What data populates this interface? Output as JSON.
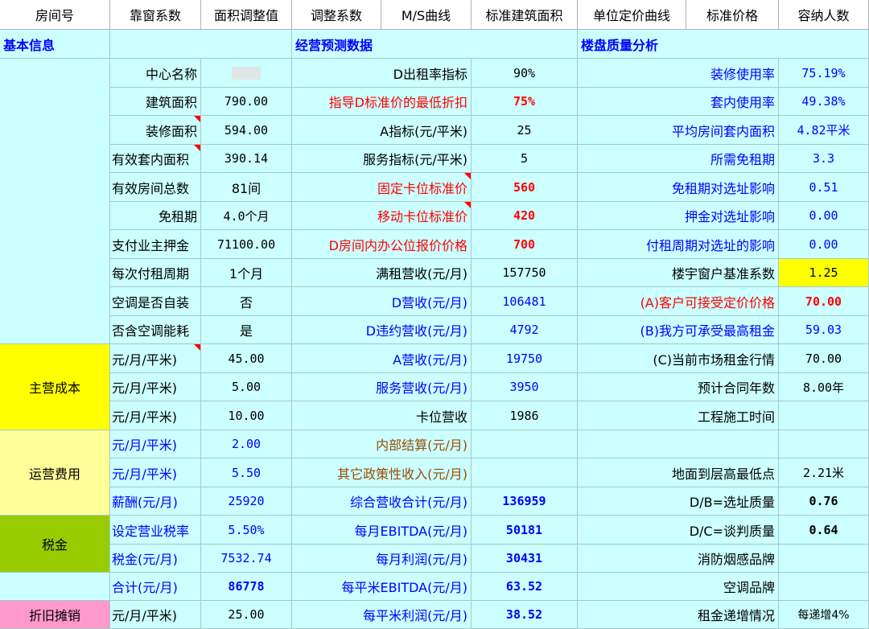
{
  "headers": [
    "房间号",
    "靠窗系数",
    "面积调整值",
    "调整系数",
    "M/S曲线",
    "标准建筑面积",
    "单位定价曲线",
    "标准价格",
    "容纳人数"
  ],
  "sections": {
    "basic": "基本信息",
    "forecast": "经营预测数据",
    "quality": "楼盘质量分析"
  },
  "categories": {
    "main_cost": "主营成本",
    "op_cost": "运营费用",
    "tax": "税金",
    "depreciation": "折旧摊销"
  },
  "colors": {
    "bg": "#ccffff",
    "yellow": "#ffff00",
    "light_yellow": "#ffff99",
    "green": "#99cc00",
    "pink": "#ff99cc",
    "red": "#ff0000",
    "blue": "#0000ff"
  },
  "rows": [
    {
      "a": "中心名称",
      "b": "",
      "c": "D出租率指标",
      "d": "90%",
      "e": "装修使用率",
      "f": "75.19%"
    },
    {
      "a": "建筑面积",
      "b": "790.00",
      "c": "指导D标准价的最低折扣",
      "d": "75%",
      "e": "套内使用率",
      "f": "49.38%"
    },
    {
      "a": "装修面积",
      "b": "594.00",
      "c": "A指标(元/平米)",
      "d": "25",
      "e": "平均房间套内面积",
      "f": "4.82平米"
    },
    {
      "a": "有效套内面积",
      "b": "390.14",
      "c": "服务指标(元/平米)",
      "d": "5",
      "e": "所需免租期",
      "f": "3.3"
    },
    {
      "a": "有效房间总数",
      "b": "81间",
      "c": "固定卡位标准价",
      "d": "560",
      "e": "免租期对选址影响",
      "f": "0.51"
    },
    {
      "a": "免租期",
      "b": "4.0个月",
      "c": "移动卡位标准价",
      "d": "420",
      "e": "押金对选址影响",
      "f": "0.00"
    },
    {
      "a": "支付业主押金",
      "b": "71100.00",
      "c": "D房间内办公位报价价格",
      "d": "700",
      "e": "付租周期对选址的影响",
      "f": "0.00"
    },
    {
      "a": "每次付租周期",
      "b": "1个月",
      "c": "满租营收(元/月)",
      "d": "157750",
      "e": "楼宇窗户基准系数",
      "f": "1.25"
    },
    {
      "a": "空调是否自装",
      "b": "否",
      "c": "D营收(元/月)",
      "d": "106481",
      "e": "(A)客户可接受定价价格",
      "f": "70.00"
    },
    {
      "a": "否含空调能耗",
      "b": "是",
      "c": "D违约营收(元/月)",
      "d": "4792",
      "e": "(B)我方可承受最高租金",
      "f": "59.03"
    },
    {
      "a": "元/月/平米)",
      "b": "45.00",
      "c": "A营收(元/月)",
      "d": "19750",
      "e": "(C)当前市场租金行情",
      "f": "70.00"
    },
    {
      "a": "元/月/平米)",
      "b": "5.00",
      "c": "服务营收(元/月)",
      "d": "3950",
      "e": "预计合同年数",
      "f": "8.00年"
    },
    {
      "a": "元/月/平米)",
      "b": "10.00",
      "c": "卡位营收",
      "d": "1986",
      "e": "工程施工时间",
      "f": ""
    },
    {
      "a": "元/月/平米)",
      "b": "2.00",
      "c": "内部结算(元/月)",
      "d": "",
      "e": "",
      "f": ""
    },
    {
      "a": "元/月/平米)",
      "b": "5.50",
      "c": "其它政策性收入(元/月)",
      "d": "",
      "e": "地面到层高最低点",
      "f": "2.21米"
    },
    {
      "a": "薪酬(元/月)",
      "b": "25920",
      "c": "综合营收合计(元/月)",
      "d": "136959",
      "e": "D/B=选址质量",
      "f": "0.76"
    },
    {
      "a": "设定营业税率",
      "b": "5.50%",
      "c": "每月EBITDA(元/月)",
      "d": "50181",
      "e": "D/C=谈判质量",
      "f": "0.64"
    },
    {
      "a": "税金(元/月)",
      "b": "7532.74",
      "c": "每月利润(元/月)",
      "d": "30431",
      "e": "消防烟感品牌",
      "f": ""
    },
    {
      "a": "合计(元/月)",
      "b": "86778",
      "c": "每平米EBITDA(元/月)",
      "d": "63.52",
      "e": "空调品牌",
      "f": ""
    },
    {
      "a": "元/月/平米)",
      "b": "25.00",
      "c": "每平米利润(元/月)",
      "d": "38.52",
      "e": "租金递增情况",
      "f": "每递增4%"
    }
  ]
}
